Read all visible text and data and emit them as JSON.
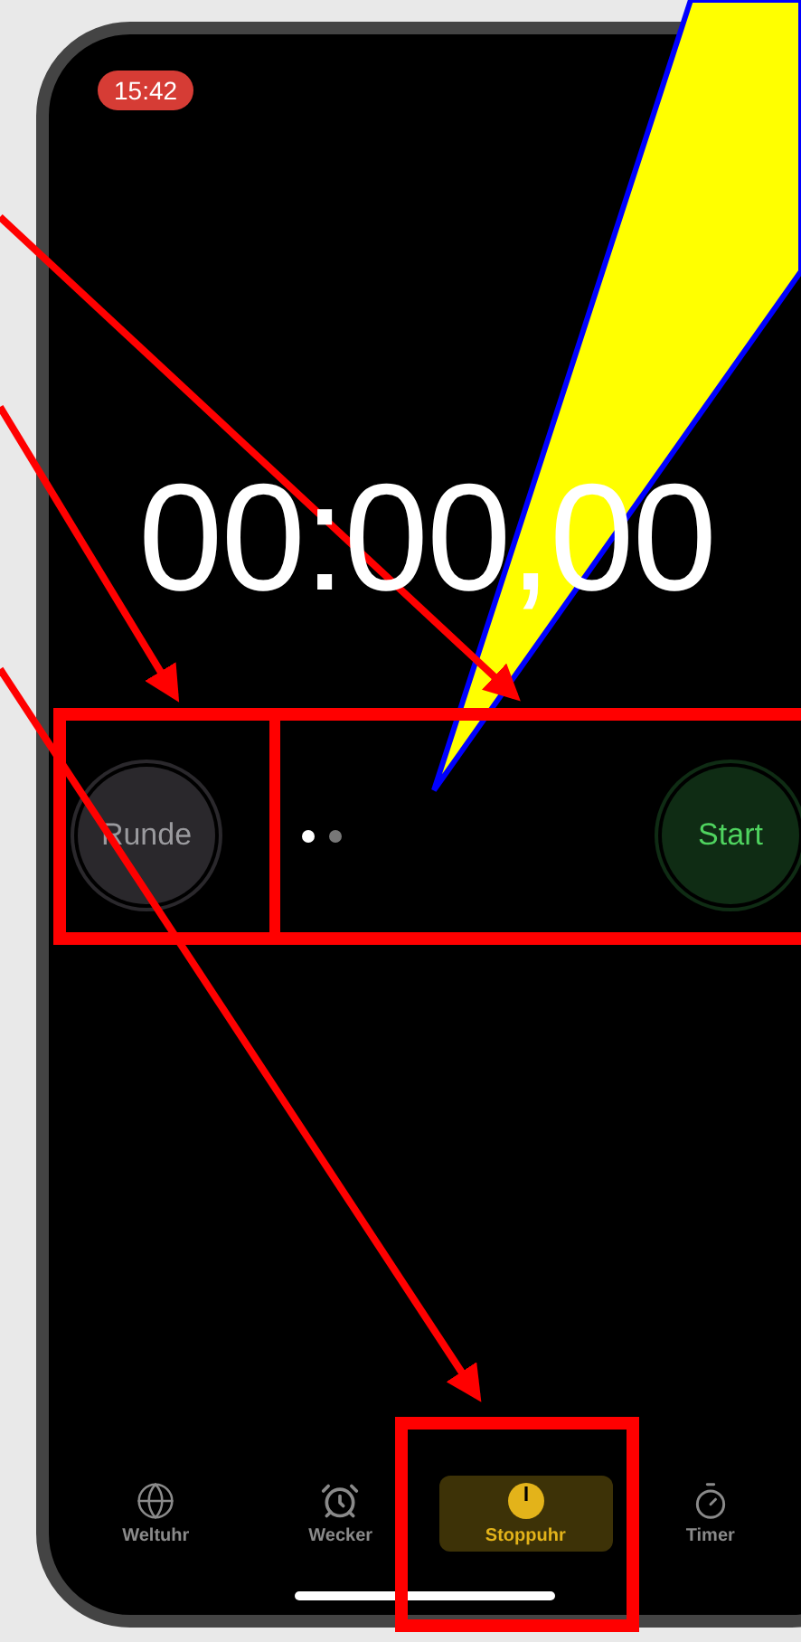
{
  "status_bar": {
    "time": "15:42"
  },
  "stopwatch": {
    "display": "00:00,00"
  },
  "controls": {
    "lap_button": "Runde",
    "start_button": "Start"
  },
  "page_dots": [
    {
      "selected": true
    },
    {
      "selected": false
    }
  ],
  "tab_bar": [
    {
      "label": "Weltuhr",
      "kind": "globe",
      "selected": false
    },
    {
      "label": "Wecker",
      "kind": "alarm",
      "selected": false
    },
    {
      "label": "Stoppuhr",
      "kind": "stopwatch",
      "selected": true
    },
    {
      "label": "Timer",
      "kind": "timer",
      "selected": false
    }
  ]
}
